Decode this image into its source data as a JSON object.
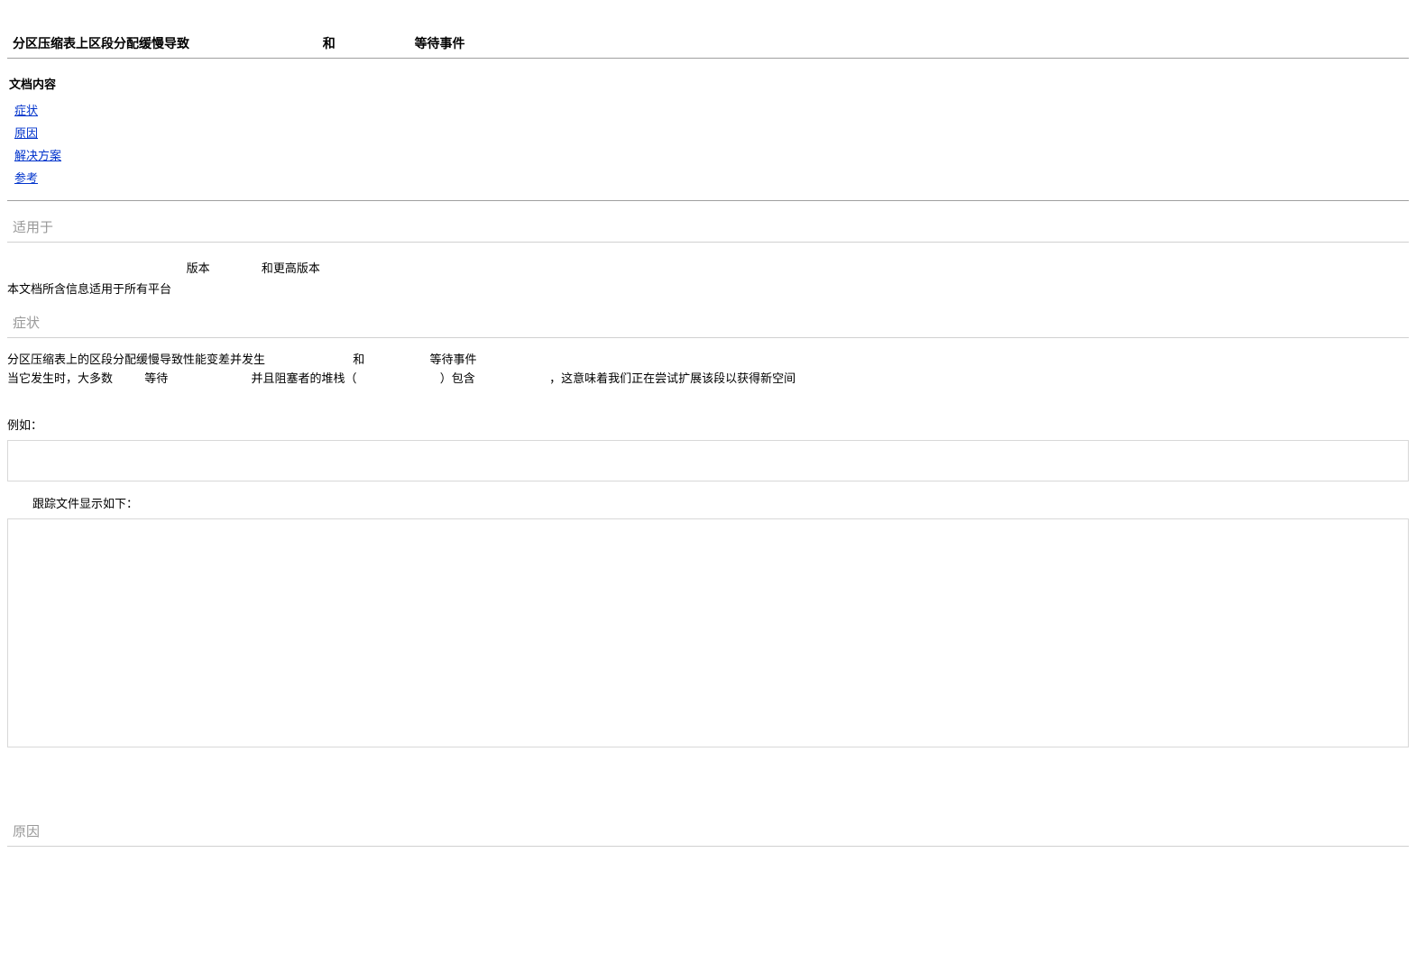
{
  "title": {
    "part1": "分区压缩表上区段分配缓慢导致",
    "mid": "和",
    "part3": "等待事件"
  },
  "toc": {
    "heading": "文档内容",
    "items": [
      "症状",
      "原因",
      "解决方案",
      "参考"
    ]
  },
  "applies": {
    "label": "适用于",
    "line1_a": "版本",
    "line1_b": "和更高版本",
    "line2": "本文档所含信息适用于所有平台"
  },
  "symptoms": {
    "label": "症状",
    "l1a": "分区压缩表上的区段分配缓慢导致性能变差并发生",
    "l1b": "和",
    "l1c": "等待事件",
    "l2a": "当它发生时，大多数",
    "l2b": "等待",
    "l2c": "并且阻塞者的堆栈（",
    "l2d": "）包含",
    "l2e": "，这意味着我们正在尝试扩展该段以获得新空间",
    "example": "例如：",
    "trace": "跟踪文件显示如下："
  },
  "cause": {
    "label": "原因"
  }
}
